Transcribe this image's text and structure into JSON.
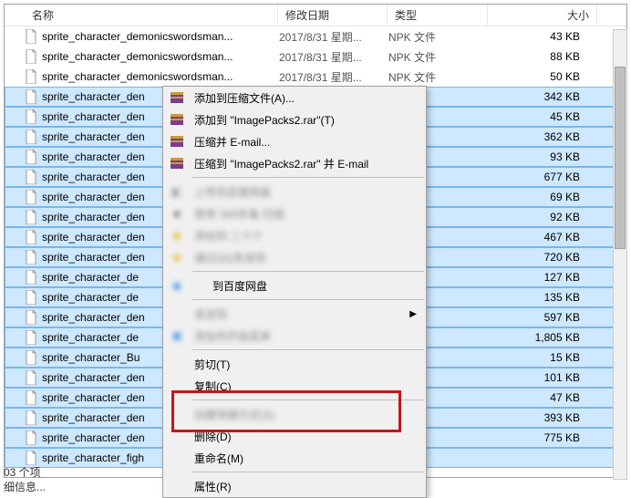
{
  "columns": {
    "name": "名称",
    "date": "修改日期",
    "type": "类型",
    "size": "大小"
  },
  "rows": [
    {
      "sel": false,
      "name": "sprite_character_demonicswordsman...",
      "date": "2017/8/31 星期...",
      "type": "NPK 文件",
      "size": "43 KB"
    },
    {
      "sel": false,
      "name": "sprite_character_demonicswordsman...",
      "date": "2017/8/31 星期...",
      "type": "NPK 文件",
      "size": "88 KB"
    },
    {
      "sel": false,
      "name": "sprite_character_demonicswordsman...",
      "date": "2017/8/31 星期...",
      "type": "NPK 文件",
      "size": "50 KB"
    },
    {
      "sel": true,
      "name": "sprite_character_den",
      "date": "",
      "type": "",
      "size": "342 KB"
    },
    {
      "sel": true,
      "name": "sprite_character_den",
      "date": "",
      "type": "",
      "size": "45 KB"
    },
    {
      "sel": true,
      "name": "sprite_character_den",
      "date": "",
      "type": "",
      "size": "362 KB"
    },
    {
      "sel": true,
      "name": "sprite_character_den",
      "date": "",
      "type": "",
      "size": "93 KB"
    },
    {
      "sel": true,
      "name": "sprite_character_den",
      "date": "",
      "type": "",
      "size": "677 KB"
    },
    {
      "sel": true,
      "name": "sprite_character_den",
      "date": "",
      "type": "",
      "size": "69 KB"
    },
    {
      "sel": true,
      "name": "sprite_character_den",
      "date": "",
      "type": "",
      "size": "92 KB"
    },
    {
      "sel": true,
      "name": "sprite_character_den",
      "date": "",
      "type": "",
      "size": "467 KB"
    },
    {
      "sel": true,
      "name": "sprite_character_den",
      "date": "",
      "type": "",
      "size": "720 KB"
    },
    {
      "sel": true,
      "name": "sprite_character_de",
      "date": "",
      "type": "",
      "size": "127 KB"
    },
    {
      "sel": true,
      "name": "sprite_character_de",
      "date": "",
      "type": "",
      "size": "135 KB"
    },
    {
      "sel": true,
      "name": "sprite_character_den",
      "date": "",
      "type": "",
      "size": "597 KB"
    },
    {
      "sel": true,
      "name": "sprite_character_de",
      "date": "",
      "type": "",
      "size": "1,805 KB"
    },
    {
      "sel": true,
      "name": "sprite_character_Bu",
      "date": "",
      "type": "",
      "size": "15 KB"
    },
    {
      "sel": true,
      "name": "sprite_character_den",
      "date": "",
      "type": "",
      "size": "101 KB"
    },
    {
      "sel": true,
      "name": "sprite_character_den",
      "date": "",
      "type": "",
      "size": "47 KB"
    },
    {
      "sel": true,
      "name": "sprite_character_den",
      "date": "",
      "type": "",
      "size": "393 KB"
    },
    {
      "sel": true,
      "name": "sprite_character_den",
      "date": "",
      "type": "",
      "size": "775 KB"
    },
    {
      "sel": true,
      "name": "sprite_character_figh",
      "date": "",
      "type": "",
      "size": ""
    }
  ],
  "menu": {
    "add_archive": "添加到压缩文件(A)...",
    "add_to": "添加到 \"ImagePacks2.rar\"(T)",
    "compress_email": "压缩并 E-mail...",
    "compress_to_email": "压缩到 \"ImagePacks2.rar\" 并 E-mail",
    "blur1": "上传到百度网盘",
    "blur2": "使用 360杀毒 扫描",
    "blur3": "添加到 二十个",
    "blur4": "通过QQ发送到",
    "baidu": "到百度网盘",
    "sendto": "发送到",
    "blur5": "添加到开始菜单",
    "cut": "剪切(T)",
    "copy": "复制(C)",
    "shortcut": "创建快捷方式(S)",
    "delete": "删除(D)",
    "rename": "重命名(M)",
    "properties": "属性(R)"
  },
  "status": {
    "line1": "03 个项",
    "line2": "细信息..."
  }
}
